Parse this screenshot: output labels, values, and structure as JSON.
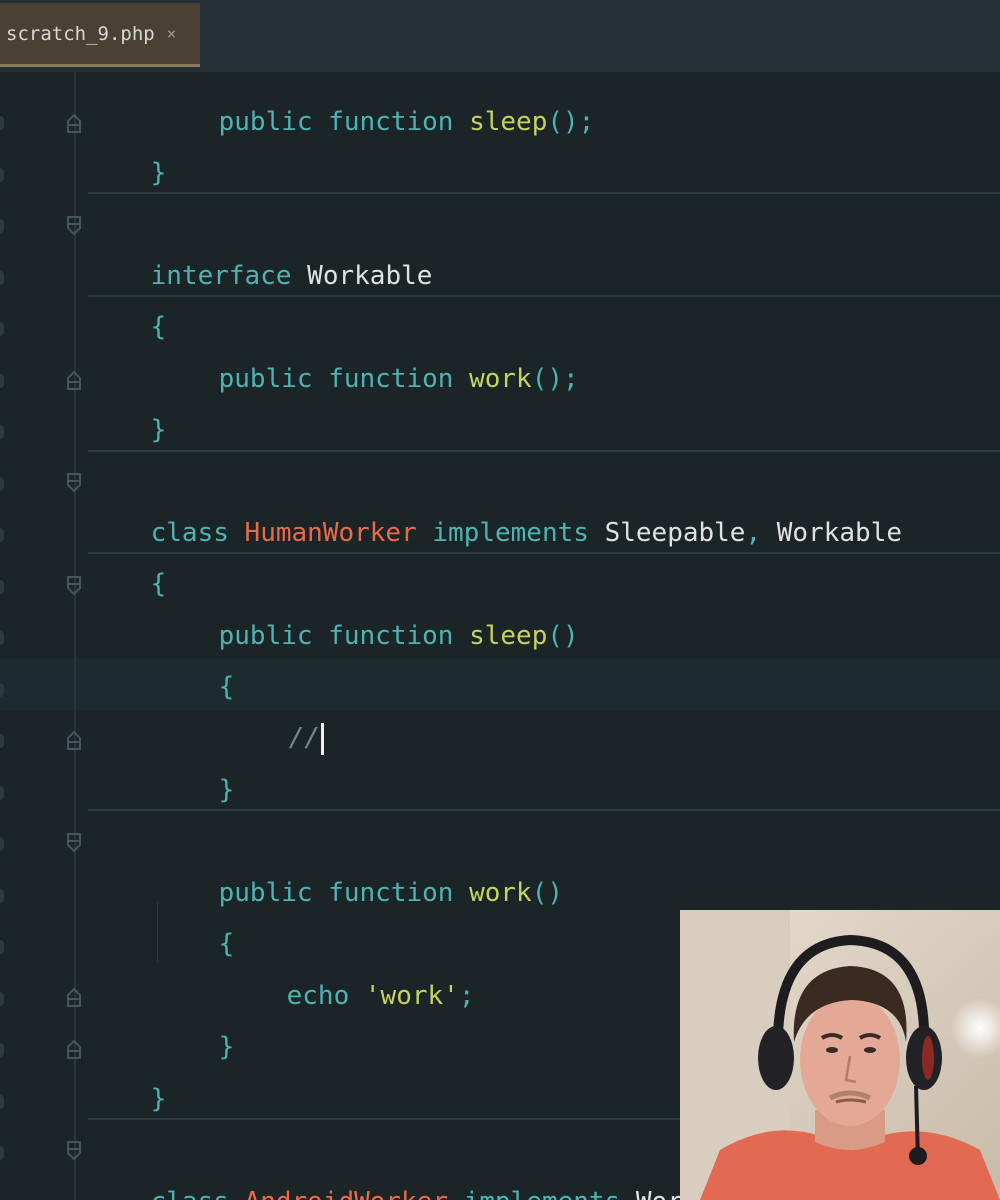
{
  "tab": {
    "filename": "scratch_9.php",
    "close_glyph": "×"
  },
  "code": {
    "line_top_partial": [
      "public ",
      "function ",
      "sleep",
      "();"
    ],
    "close_brace_1": "}",
    "interface_kw": "interface ",
    "interface_name": "Workable",
    "open_brace_2": "{",
    "work_sig_public": "public ",
    "work_sig_function": "function ",
    "work_sig_name": "work",
    "work_sig_end": "();",
    "close_brace_2": "}",
    "class_kw": "class ",
    "class_name": "HumanWorker",
    "implements_kw": " implements ",
    "iface_a": "Sleepable",
    "comma": ", ",
    "iface_b": "Workable",
    "open_brace_3": "{",
    "sleep_public": "public ",
    "sleep_function": "function ",
    "sleep_name": "sleep",
    "sleep_parens": "()",
    "sleep_open": "{",
    "comment": "//",
    "sleep_close": "}",
    "work_public": "public ",
    "work_function": "function ",
    "work_name": "work",
    "work_parens": "()",
    "work_open": "{",
    "echo_kw": "echo ",
    "echo_str": "'work'",
    "echo_end": ";",
    "work_close": "}",
    "class_close": "}",
    "class2_kw": "class ",
    "class2_name": "AndroidWorker",
    "class2_implements": " implements ",
    "class2_iface": "Work"
  },
  "colors": {
    "background": "#1b2528",
    "keyword": "#4fb3b3",
    "function_name": "#c8d25e",
    "class_name": "#e86a4a",
    "identifier": "#e1e1e1",
    "string": "#c8d25e"
  },
  "webcam": {
    "icon": "webcam-overlay"
  }
}
